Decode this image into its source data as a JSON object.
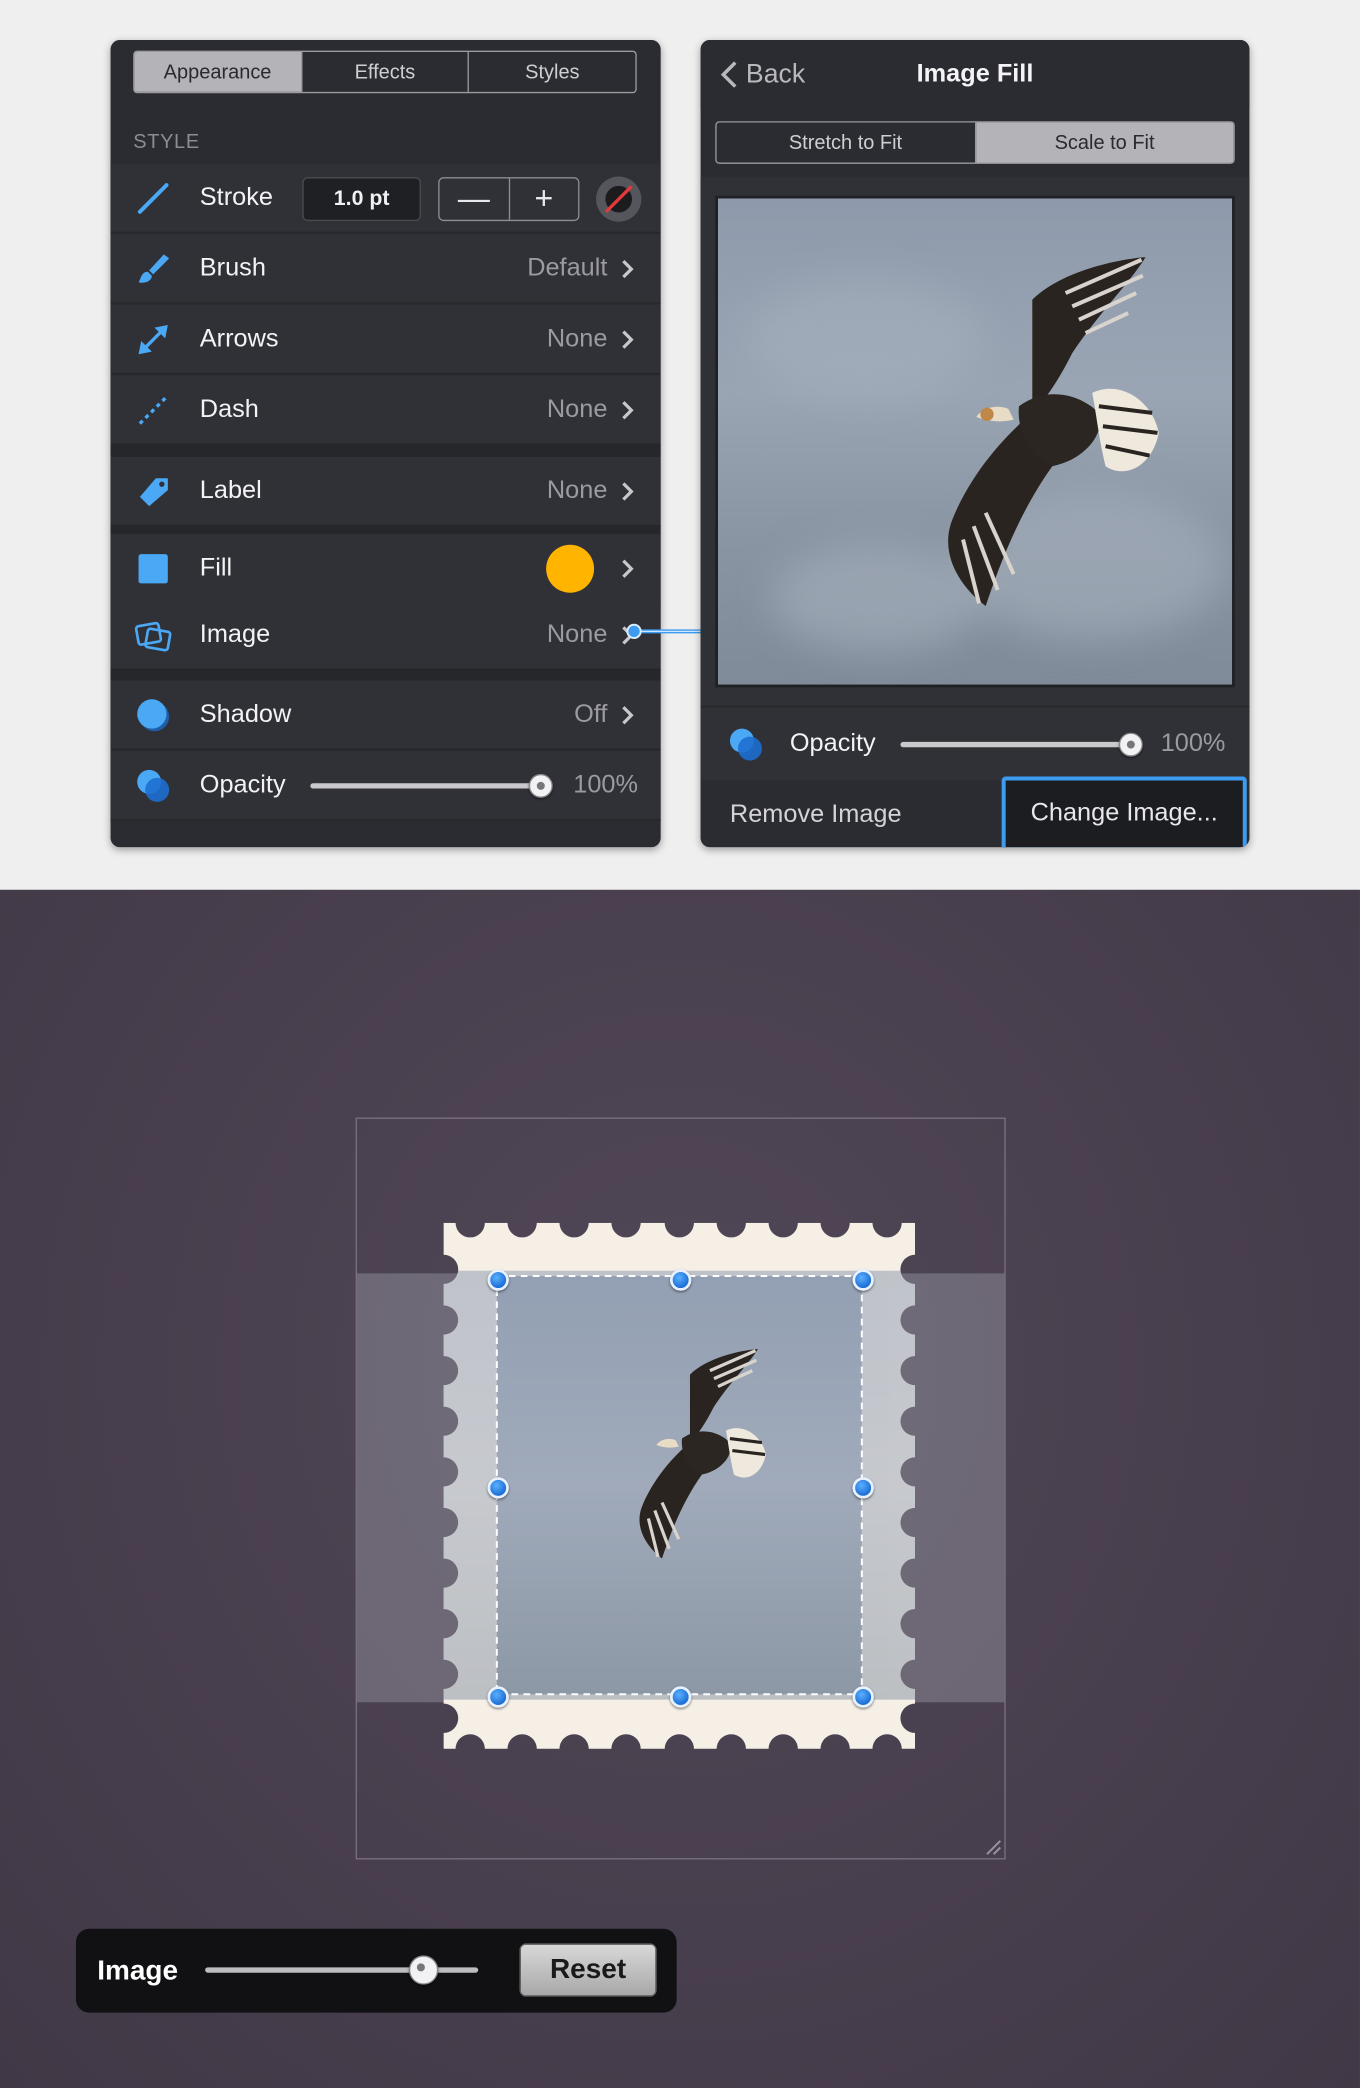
{
  "inspector": {
    "tabs": [
      {
        "label": "Appearance",
        "selected": true
      },
      {
        "label": "Effects",
        "selected": false
      },
      {
        "label": "Styles",
        "selected": false
      }
    ],
    "section_title": "STYLE",
    "stroke": {
      "label": "Stroke",
      "value": "1.0 pt",
      "minus": "—",
      "plus": "+"
    },
    "rows": {
      "brush": {
        "label": "Brush",
        "value": "Default"
      },
      "arrows": {
        "label": "Arrows",
        "value": "None"
      },
      "dash": {
        "label": "Dash",
        "value": "None"
      },
      "label": {
        "label": "Label",
        "value": "None"
      },
      "fill": {
        "label": "Fill",
        "color": "#ffb400"
      },
      "image": {
        "label": "Image",
        "value": "None"
      },
      "shadow": {
        "label": "Shadow",
        "value": "Off"
      },
      "opacity": {
        "label": "Opacity",
        "value": "100%",
        "level": 1.0
      }
    }
  },
  "image_fill": {
    "back_label": "Back",
    "title": "Image Fill",
    "modes": [
      {
        "label": "Stretch to Fit",
        "selected": false
      },
      {
        "label": "Scale to Fit",
        "selected": true
      }
    ],
    "opacity": {
      "label": "Opacity",
      "value": "100%",
      "level": 1.0
    },
    "remove_label": "Remove Image",
    "change_label": "Change Image..."
  },
  "image_toolbar": {
    "label": "Image",
    "slider_level": 0.8,
    "reset_label": "Reset"
  },
  "colors": {
    "accent": "#3d9bf0",
    "panel_bg": "#2b2c31",
    "canvas_bg": "#4a4050",
    "fill_swatch": "#ffb400"
  }
}
